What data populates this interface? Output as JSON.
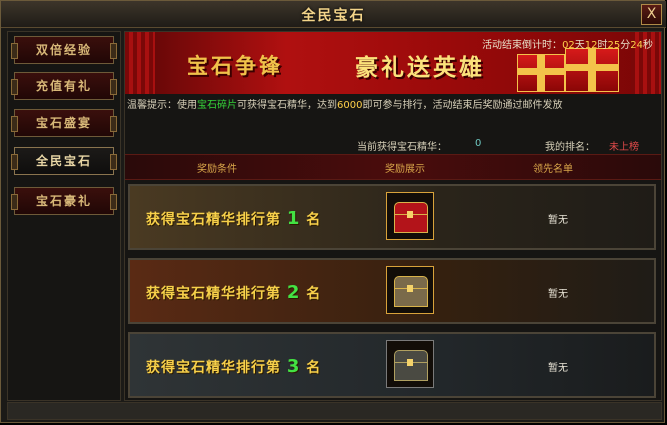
{
  "window": {
    "title": "全民宝石",
    "close_label": "X"
  },
  "sidebar": {
    "items": [
      {
        "label": "双倍经验",
        "active": false
      },
      {
        "label": "充值有礼",
        "active": false
      },
      {
        "label": "宝石盛宴",
        "active": false
      },
      {
        "label": "全民宝石",
        "active": true
      },
      {
        "label": "宝石豪礼",
        "active": false
      }
    ]
  },
  "banner": {
    "title_left": "宝石争锋",
    "title_right": "豪礼送英雄"
  },
  "countdown": {
    "prefix": "活动结束倒计时：",
    "days": "02",
    "days_unit": "天",
    "hours": "12",
    "hours_unit": "时",
    "minutes": "25",
    "minutes_unit": "分",
    "seconds": "24",
    "seconds_unit": "秒"
  },
  "tips": {
    "prefix": "温馨提示：使用",
    "highlight_item": "宝石碎片",
    "mid": "可获得宝石精华，达到",
    "threshold": "6000",
    "suffix": "即可参与排行，活动结束后奖励通过邮件发放"
  },
  "status": {
    "essence_label": "当前获得宝石精华：",
    "essence_value": "0",
    "rank_label": "我的排名：",
    "rank_value": "未上榜"
  },
  "table": {
    "headers": [
      "奖励条件",
      "奖励展示",
      "领先名单"
    ],
    "rows": [
      {
        "cond_prefix": "获得宝石精华排行第",
        "rank": "1",
        "cond_suffix": "名",
        "reward_icon": "red-treasure-chest-icon",
        "leader": "暂无"
      },
      {
        "cond_prefix": "获得宝石精华排行第",
        "rank": "2",
        "cond_suffix": "名",
        "reward_icon": "gold-treasure-chest-icon",
        "leader": "暂无"
      },
      {
        "cond_prefix": "获得宝石精华排行第",
        "rank": "3",
        "cond_suffix": "名",
        "reward_icon": "silver-treasure-chest-icon",
        "leader": "暂无"
      }
    ]
  },
  "colors": {
    "title_gold": "#f4d58a",
    "rank_number_green": "#43e243",
    "highlight_green": "#36d43a",
    "countdown_yellow": "#ffd04a",
    "rank_red": "#e24a4a"
  }
}
